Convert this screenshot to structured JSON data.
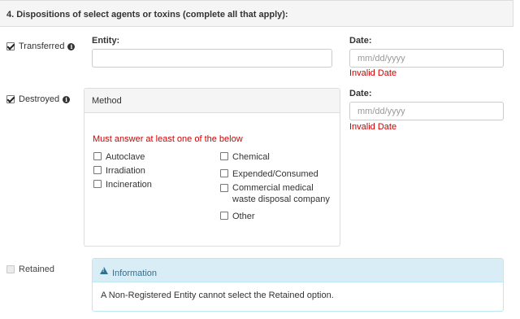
{
  "section": {
    "title": "4. Dispositions of select agents or toxins (complete all that apply):"
  },
  "transferred": {
    "label": "Transferred",
    "checked": true,
    "entity_label": "Entity:",
    "entity_value": "",
    "date_label": "Date:",
    "date_placeholder": "mm/dd/yyyy",
    "date_error": "Invalid Date"
  },
  "destroyed": {
    "label": "Destroyed",
    "checked": true,
    "date_label": "Date:",
    "date_placeholder": "mm/dd/yyyy",
    "date_error": "Invalid Date",
    "method": {
      "title": "Method",
      "error": "Must answer at least one of the below",
      "options_left": [
        "Autoclave",
        "Irradiation",
        "Incineration"
      ],
      "options_right": [
        "Chemical",
        "Expended/Consumed",
        "Commercial medical waste disposal company",
        "Other"
      ]
    }
  },
  "retained": {
    "label": "Retained",
    "checked": false,
    "disabled": true,
    "info_title": "Information",
    "info_text": "A Non-Registered Entity cannot select the Retained option."
  },
  "icons": {
    "info": "info-circle-icon",
    "warning": "warning-triangle-icon",
    "check": "checkmark-icon"
  },
  "colors": {
    "error": "#d00000",
    "info_bg": "#d9edf7",
    "info_text": "#31708f",
    "panel_border": "#dddddd"
  }
}
